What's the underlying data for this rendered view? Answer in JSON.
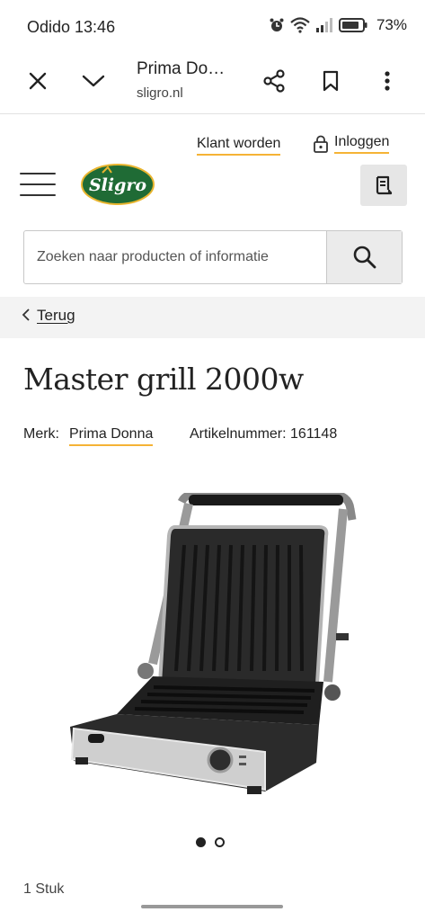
{
  "status_bar": {
    "carrier_time": "Odido 13:46",
    "battery": "73%"
  },
  "browser": {
    "title": "Prima Do…",
    "url": "sligro.nl",
    "icons": [
      "close-icon",
      "chevron-down-icon",
      "share-icon",
      "bookmark-icon",
      "more-vert-icon"
    ]
  },
  "header": {
    "register_label": "Klant worden",
    "login_label": "Inloggen",
    "logo_text": "Sligro",
    "accent_color": "#f5b335",
    "logo_color": "#1f6b35"
  },
  "search": {
    "placeholder": "Zoeken naar producten of informatie"
  },
  "nav": {
    "back_label": "Terug"
  },
  "product": {
    "title": "Master grill 2000w",
    "brand_label": "Merk:",
    "brand": "Prima Donna",
    "article_number": "Artikelnummer: 161148",
    "image_count": 2,
    "active_image": 1,
    "unit": "1 Stuk"
  }
}
